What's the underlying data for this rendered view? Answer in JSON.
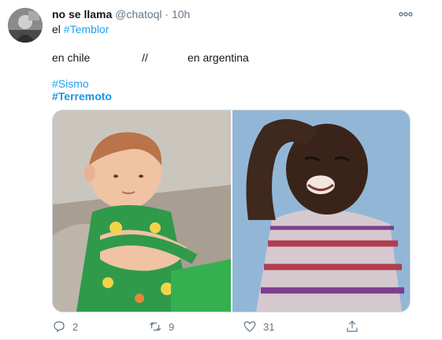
{
  "tweet": {
    "display_name": "no se llama",
    "handle": "@chatoql",
    "separator": "·",
    "time": "10h",
    "line1_prefix": "el ",
    "line1_hashtag": "#Temblor",
    "line2_left": "en chile",
    "line2_mid": "//",
    "line2_right": "en argentina",
    "hashtag_sismo": "#Sismo",
    "hashtag_terremoto": "#Terremoto",
    "reply_count": "2",
    "retweet_count": "9",
    "like_count": "31"
  },
  "colors": {
    "link": "#1da1f2",
    "muted": "#657786",
    "text": "#14171a"
  },
  "icons": [
    "more-icon",
    "reply-icon",
    "retweet-icon",
    "like-icon",
    "share-icon"
  ]
}
